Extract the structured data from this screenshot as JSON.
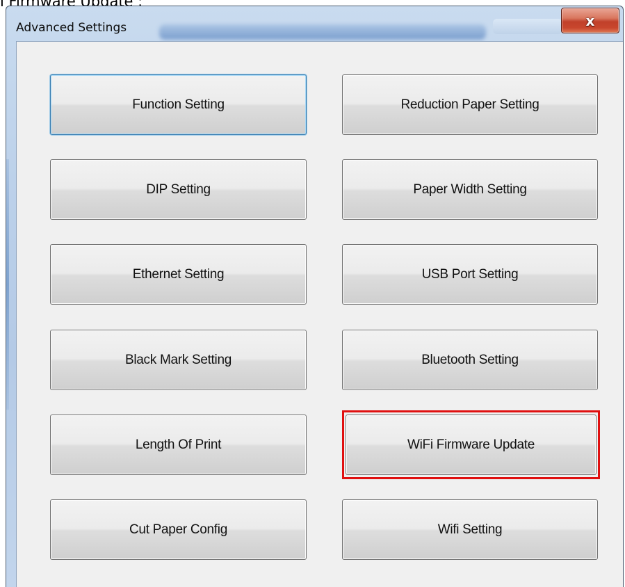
{
  "caption": "i Firmware Update :",
  "window": {
    "title": "Advanced Settings",
    "close_label": "x"
  },
  "buttons": [
    {
      "label": "Function Setting",
      "focused": true
    },
    {
      "label": "Reduction Paper Setting"
    },
    {
      "label": "DIP Setting"
    },
    {
      "label": "Paper Width Setting"
    },
    {
      "label": "Ethernet Setting"
    },
    {
      "label": "USB Port Setting"
    },
    {
      "label": "Black Mark Setting"
    },
    {
      "label": "Bluetooth Setting"
    },
    {
      "label": "Length Of Print"
    },
    {
      "label": "WiFi Firmware Update",
      "highlighted": true
    },
    {
      "label": "Cut Paper Config"
    },
    {
      "label": "Wifi Setting"
    }
  ],
  "colors": {
    "highlight": "#e01010",
    "focus_border": "#3c7fb1",
    "close_button": "#c8462d"
  }
}
